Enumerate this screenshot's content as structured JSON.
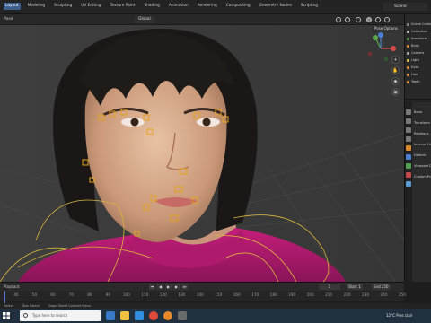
{
  "workspace_tabs": [
    {
      "label": "Layout",
      "active": true
    },
    {
      "label": "Modeling",
      "active": false
    },
    {
      "label": "Sculpting",
      "active": false
    },
    {
      "label": "UV Editing",
      "active": false
    },
    {
      "label": "Texture Paint",
      "active": false
    },
    {
      "label": "Shading",
      "active": false
    },
    {
      "label": "Animation",
      "active": false
    },
    {
      "label": "Rendering",
      "active": false
    },
    {
      "label": "Compositing",
      "active": false
    },
    {
      "label": "Geometry Nodes",
      "active": false
    },
    {
      "label": "Scripting",
      "active": false
    }
  ],
  "scene_name": "Scene",
  "viewport": {
    "mode_label": "Pose",
    "transform_orientation": "Global",
    "pose_options_label": "Pose Options",
    "gizmo_axes": [
      "X",
      "Y",
      "Z"
    ]
  },
  "outliner": {
    "rows": [
      "Scene Collection",
      "Collection",
      "Armature",
      "Body",
      "Camera",
      "Light",
      "Eyes",
      "Hair",
      "Teeth"
    ]
  },
  "properties": {
    "rows": [
      "Bone",
      "Transform",
      "Relations",
      "Inverse Kinematics",
      "Deform",
      "Viewport Display",
      "Custom Properties"
    ]
  },
  "timeline": {
    "mode_label": "Playback",
    "current_frame": "1",
    "start_label": "Start",
    "start_value": "1",
    "end_label": "End",
    "end_value": "250",
    "ticks": [
      "40",
      "50",
      "60",
      "70",
      "80",
      "90",
      "100",
      "110",
      "120",
      "130",
      "140",
      "150",
      "160",
      "170",
      "180",
      "190",
      "200",
      "210",
      "220",
      "230",
      "240",
      "250"
    ]
  },
  "status_bar": {
    "items": [
      "Select",
      "Box Select",
      "Dope Sheet Context Menu"
    ]
  },
  "taskbar": {
    "search_placeholder": "Type here to search",
    "weather": "12°C",
    "weather_desc": "Pres clair"
  },
  "colors": {
    "accent": "#3d5f8f",
    "rig_orange": "#e6a21a",
    "rig_yellow": "#d9b43a",
    "shirt": "#c41e7a"
  },
  "icons": [
    "windows-logo-icon",
    "search-icon",
    "file-explorer-icon",
    "edge-icon",
    "chrome-icon",
    "blender-icon",
    "settings-icon",
    "folder-icon"
  ]
}
